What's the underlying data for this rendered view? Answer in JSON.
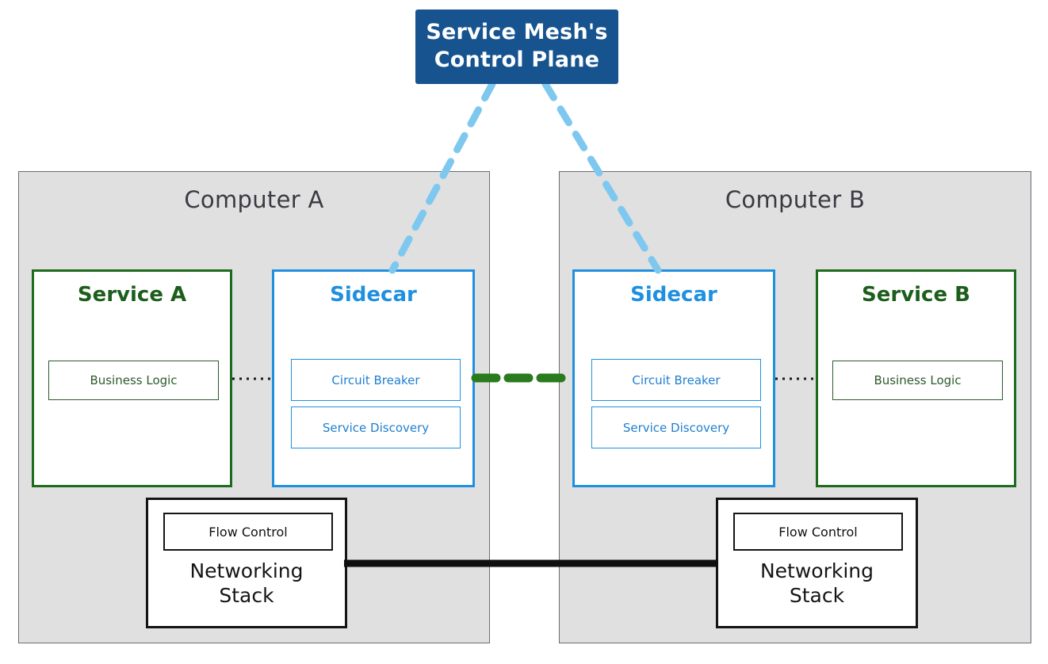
{
  "diagram": {
    "title_text": "Service Mesh's\nControl Plane",
    "control_plane": {
      "label": "Service Mesh's\nControl Plane",
      "bg_color": "#17548f",
      "text_color": "#ffffff"
    },
    "panels": [
      {
        "id": "computer-a",
        "title": "Computer A",
        "service": {
          "title": "Service A",
          "inner": [
            "Business Logic"
          ],
          "border_color": "#1e6b1e"
        },
        "sidecar": {
          "title": "Sidecar",
          "inner": [
            "Circuit Breaker",
            "Service Discovery"
          ],
          "border_color": "#1f90e0"
        },
        "networking": {
          "inner": "Flow Control",
          "label": "Networking\nStack"
        }
      },
      {
        "id": "computer-b",
        "title": "Computer B",
        "service": {
          "title": "Service B",
          "inner": [
            "Business Logic"
          ],
          "border_color": "#1e6b1e"
        },
        "sidecar": {
          "title": "Sidecar",
          "inner": [
            "Circuit Breaker",
            "Service Discovery"
          ],
          "border_color": "#1f90e0"
        },
        "networking": {
          "inner": "Flow Control",
          "label": "Networking\nStack"
        }
      }
    ],
    "connectors": {
      "control_plane_to_sidecar": {
        "style": "dashed",
        "color": "#7ec8f0",
        "description": "control-plane to sidecar link"
      },
      "service_to_sidecar": {
        "style": "dotted",
        "color": "#1a1a1a",
        "description": "service to sidecar link"
      },
      "sidecar_to_sidecar": {
        "style": "dashed",
        "color": "#2a7a1e",
        "description": "sidecar to sidecar traffic"
      },
      "network_to_network": {
        "style": "solid",
        "color": "#101010",
        "description": "networking stack physical link"
      }
    },
    "colors": {
      "panel_bg": "#e0e0e0",
      "panel_border": "#6b6b77",
      "green": "#1e6b1e",
      "blue": "#1f90e0",
      "dark_blue": "#17548f",
      "light_blue": "#7ec8f0",
      "black": "#141414"
    }
  }
}
